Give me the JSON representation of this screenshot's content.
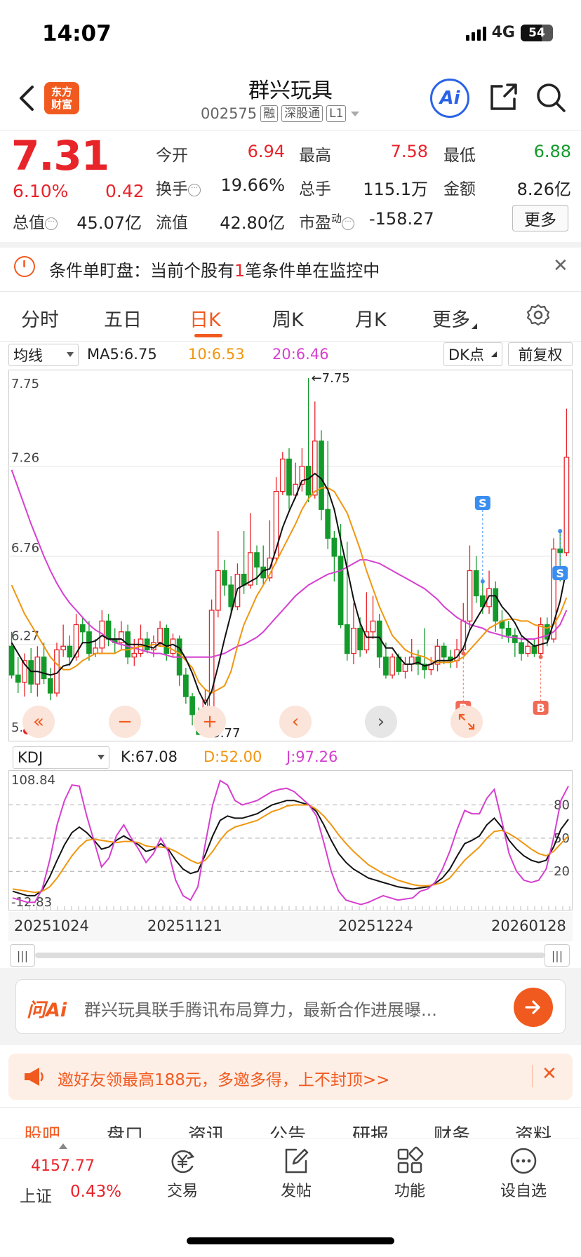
{
  "status_bar": {
    "time": "14:07",
    "network": "4G",
    "battery": "54"
  },
  "header": {
    "title": "群兴玩具",
    "code": "002575",
    "tags": [
      "融",
      "深股通",
      "L1"
    ],
    "logo": "东方财富",
    "ai_label": "Ai"
  },
  "quote": {
    "price": "7.31",
    "change_pct": "6.10%",
    "change": "0.42",
    "fields": [
      {
        "label": "今开",
        "value": "6.94",
        "color": "red"
      },
      {
        "label": "最高",
        "value": "7.58",
        "color": "red"
      },
      {
        "label": "最低",
        "value": "6.88",
        "color": "green"
      },
      {
        "label": "换手",
        "value": "19.66%",
        "color": "black"
      },
      {
        "label": "总手",
        "value": "115.1万",
        "color": "black"
      },
      {
        "label": "金额",
        "value": "8.26亿",
        "color": "black"
      },
      {
        "label": "总值",
        "value": "45.07亿",
        "color": "black"
      },
      {
        "label": "流值",
        "value": "42.80亿",
        "color": "black"
      },
      {
        "label": "市盈",
        "value": "-158.27",
        "color": "black"
      }
    ],
    "pe_sup": "动",
    "more_label": "更多"
  },
  "condition_banner": {
    "prefix": "条件单盯盘：当前个股有",
    "count": "1",
    "suffix": "笔条件单在监控中"
  },
  "tabs": [
    "分时",
    "五日",
    "日K",
    "周K",
    "月K",
    "更多"
  ],
  "active_tab": "日K",
  "indicator_row": {
    "selector": "均线",
    "ma5": "MA5:6.75",
    "ma10": "10:6.53",
    "ma20": "20:6.46",
    "dk_label": "DK点",
    "adjust_label": "前复权"
  },
  "kdj_row": {
    "selector": "KDJ",
    "k": "K:67.08",
    "d": "D:52.00",
    "j": "J:97.26"
  },
  "colors": {
    "up": "#e8242b",
    "down": "#139a2a",
    "ma5": "#111111",
    "ma10": "#f0960f",
    "ma20": "#d63fd0",
    "accent": "#f15a1f"
  },
  "chart_data": [
    {
      "type": "candlestick",
      "y_labels": [
        "7.75",
        "7.26",
        "6.76",
        "6.27",
        "5.77"
      ],
      "ylim": [
        5.77,
        7.75
      ],
      "max_label": "7.75",
      "min_label": "5.77",
      "signals": [
        "S",
        "S",
        "B",
        "B"
      ],
      "candles": [
        [
          6.26,
          6.1,
          6.34,
          6.08
        ],
        [
          6.1,
          6.06,
          6.2,
          6.0
        ],
        [
          6.06,
          6.18,
          6.22,
          5.98
        ],
        [
          6.18,
          6.05,
          6.25,
          6.0
        ],
        [
          6.05,
          6.2,
          6.26,
          5.98
        ],
        [
          6.2,
          6.08,
          6.28,
          6.05
        ],
        [
          6.08,
          6.0,
          6.14,
          5.96
        ],
        [
          6.0,
          6.24,
          6.28,
          5.98
        ],
        [
          6.24,
          6.26,
          6.38,
          6.2
        ],
        [
          6.26,
          6.2,
          6.32,
          6.15
        ],
        [
          6.2,
          6.38,
          6.44,
          6.18
        ],
        [
          6.38,
          6.34,
          6.42,
          6.28
        ],
        [
          6.34,
          6.22,
          6.4,
          6.18
        ],
        [
          6.22,
          6.25,
          6.3,
          6.2
        ],
        [
          6.25,
          6.4,
          6.46,
          6.22
        ],
        [
          6.4,
          6.3,
          6.44,
          6.26
        ],
        [
          6.3,
          6.28,
          6.36,
          6.22
        ],
        [
          6.28,
          6.34,
          6.4,
          6.24
        ],
        [
          6.34,
          6.2,
          6.38,
          6.16
        ],
        [
          6.2,
          6.22,
          6.3,
          6.15
        ],
        [
          6.22,
          6.3,
          6.38,
          6.2
        ],
        [
          6.3,
          6.24,
          6.34,
          6.22
        ],
        [
          6.24,
          6.28,
          6.32,
          6.2
        ],
        [
          6.28,
          6.36,
          6.4,
          6.26
        ],
        [
          6.36,
          6.22,
          6.38,
          6.18
        ],
        [
          6.22,
          6.3,
          6.33,
          6.2
        ],
        [
          6.3,
          6.1,
          6.32,
          6.04
        ],
        [
          6.1,
          5.98,
          6.14,
          5.94
        ],
        [
          5.98,
          5.88,
          6.0,
          5.82
        ],
        [
          5.88,
          5.77,
          5.92,
          5.77
        ],
        [
          5.84,
          5.96,
          6.02,
          5.82
        ],
        [
          5.92,
          6.46,
          6.52,
          5.9
        ],
        [
          6.46,
          6.68,
          6.9,
          6.42
        ],
        [
          6.68,
          6.6,
          6.74,
          6.54
        ],
        [
          6.6,
          6.48,
          6.65,
          6.44
        ],
        [
          6.48,
          6.66,
          6.72,
          6.46
        ],
        [
          6.66,
          6.6,
          6.9,
          6.55
        ],
        [
          6.6,
          6.78,
          7.0,
          6.58
        ],
        [
          6.78,
          6.7,
          6.82,
          6.6
        ],
        [
          6.7,
          6.64,
          6.82,
          6.6
        ],
        [
          6.64,
          6.75,
          6.96,
          6.62
        ],
        [
          6.75,
          7.12,
          7.2,
          6.72
        ],
        [
          7.12,
          7.3,
          7.34,
          7.1
        ],
        [
          7.3,
          7.1,
          7.36,
          7.02
        ],
        [
          7.1,
          7.16,
          7.28,
          7.08
        ],
        [
          7.16,
          7.26,
          7.36,
          7.12
        ],
        [
          7.26,
          7.1,
          7.75,
          7.06
        ],
        [
          7.1,
          7.4,
          7.62,
          7.08
        ],
        [
          7.4,
          7.02,
          7.46,
          6.96
        ],
        [
          7.02,
          6.86,
          7.4,
          6.8
        ],
        [
          6.86,
          6.76,
          6.9,
          6.62
        ],
        [
          6.76,
          6.38,
          6.94,
          6.36
        ],
        [
          6.38,
          6.22,
          6.84,
          6.18
        ],
        [
          6.22,
          6.36,
          6.5,
          6.16
        ],
        [
          6.36,
          6.24,
          6.42,
          6.2
        ],
        [
          6.24,
          6.34,
          6.56,
          6.22
        ],
        [
          6.34,
          6.4,
          6.54,
          6.3
        ],
        [
          6.4,
          6.2,
          6.44,
          6.14
        ],
        [
          6.2,
          6.1,
          6.28,
          6.08
        ],
        [
          6.1,
          6.2,
          6.22,
          6.08
        ],
        [
          6.2,
          6.12,
          6.22,
          6.1
        ],
        [
          6.12,
          6.16,
          6.2,
          6.08
        ],
        [
          6.16,
          6.2,
          6.3,
          6.12
        ],
        [
          6.2,
          6.16,
          6.24,
          6.1
        ],
        [
          6.16,
          6.13,
          6.36,
          6.08
        ],
        [
          6.13,
          6.16,
          6.2,
          6.1
        ],
        [
          6.16,
          6.26,
          6.3,
          6.12
        ],
        [
          6.26,
          6.2,
          6.28,
          6.16
        ],
        [
          6.2,
          6.18,
          6.24,
          6.14
        ],
        [
          6.18,
          6.24,
          6.3,
          6.14
        ],
        [
          6.24,
          6.4,
          6.5,
          6.22
        ],
        [
          6.4,
          6.68,
          6.82,
          6.36
        ],
        [
          6.68,
          6.54,
          6.76,
          6.5
        ],
        [
          6.54,
          6.48,
          6.62,
          6.44
        ],
        [
          6.48,
          6.58,
          6.68,
          6.44
        ],
        [
          6.58,
          6.4,
          6.62,
          6.34
        ],
        [
          6.4,
          6.36,
          6.46,
          6.3
        ],
        [
          6.36,
          6.32,
          6.4,
          6.28
        ],
        [
          6.32,
          6.28,
          6.36,
          6.2
        ],
        [
          6.28,
          6.22,
          6.32,
          6.18
        ],
        [
          6.22,
          6.26,
          6.3,
          6.2
        ],
        [
          6.26,
          6.22,
          6.3,
          6.2
        ],
        [
          6.22,
          6.38,
          6.42,
          6.2
        ],
        [
          6.38,
          6.3,
          6.42,
          6.26
        ],
        [
          6.3,
          6.8,
          6.86,
          6.28
        ],
        [
          6.8,
          6.78,
          6.9,
          6.62
        ],
        [
          6.78,
          7.31,
          7.58,
          6.76
        ]
      ],
      "ma5": [
        6.28,
        6.22,
        6.16,
        6.12,
        6.12,
        6.11,
        6.1,
        6.11,
        6.15,
        6.16,
        6.22,
        6.28,
        6.28,
        6.29,
        6.32,
        6.3,
        6.3,
        6.3,
        6.27,
        6.27,
        6.27,
        6.26,
        6.25,
        6.28,
        6.26,
        6.27,
        6.25,
        6.19,
        6.11,
        6.01,
        5.94,
        6.01,
        6.15,
        6.3,
        6.44,
        6.58,
        6.6,
        6.62,
        6.64,
        6.68,
        6.69,
        6.8,
        6.92,
        7.01,
        7.09,
        7.18,
        7.19,
        7.22,
        7.19,
        7.13,
        7.02,
        6.85,
        6.69,
        6.52,
        6.39,
        6.31,
        6.31,
        6.31,
        6.25,
        6.25,
        6.2,
        6.16,
        6.16,
        6.17,
        6.15,
        6.16,
        6.18,
        6.18,
        6.18,
        6.2,
        6.25,
        6.35,
        6.41,
        6.47,
        6.54,
        6.54,
        6.48,
        6.44,
        6.39,
        6.32,
        6.29,
        6.26,
        6.27,
        6.28,
        6.39,
        6.51,
        6.69
      ],
      "ma10": [
        6.6,
        6.52,
        6.44,
        6.38,
        6.32,
        6.26,
        6.2,
        6.16,
        6.13,
        6.13,
        6.15,
        6.18,
        6.2,
        6.22,
        6.22,
        6.22,
        6.22,
        6.24,
        6.24,
        6.25,
        6.26,
        6.26,
        6.27,
        6.26,
        6.26,
        6.24,
        6.22,
        6.18,
        6.14,
        6.06,
        6.02,
        6.0,
        6.02,
        6.04,
        6.12,
        6.26,
        6.38,
        6.46,
        6.54,
        6.6,
        6.66,
        6.73,
        6.8,
        6.87,
        6.94,
        7.02,
        7.08,
        7.12,
        7.14,
        7.14,
        7.12,
        7.06,
        7.0,
        6.9,
        6.8,
        6.68,
        6.58,
        6.48,
        6.4,
        6.32,
        6.28,
        6.24,
        6.22,
        6.21,
        6.2,
        6.18,
        6.17,
        6.17,
        6.17,
        6.18,
        6.2,
        6.24,
        6.28,
        6.32,
        6.36,
        6.38,
        6.4,
        6.41,
        6.41,
        6.4,
        6.4,
        6.38,
        6.37,
        6.36,
        6.38,
        6.44,
        6.53
      ],
      "ma20": [
        7.24,
        7.14,
        7.04,
        6.94,
        6.85,
        6.76,
        6.68,
        6.61,
        6.55,
        6.5,
        6.46,
        6.42,
        6.38,
        6.35,
        6.33,
        6.3,
        6.28,
        6.27,
        6.26,
        6.25,
        6.24,
        6.23,
        6.22,
        6.22,
        6.21,
        6.2,
        6.2,
        6.2,
        6.2,
        6.2,
        6.2,
        6.2,
        6.21,
        6.22,
        6.24,
        6.26,
        6.27,
        6.29,
        6.31,
        6.34,
        6.38,
        6.42,
        6.46,
        6.5,
        6.54,
        6.57,
        6.6,
        6.62,
        6.64,
        6.66,
        6.67,
        6.68,
        6.7,
        6.72,
        6.74,
        6.74,
        6.73,
        6.72,
        6.7,
        6.68,
        6.66,
        6.64,
        6.62,
        6.6,
        6.58,
        6.55,
        6.52,
        6.48,
        6.45,
        6.42,
        6.4,
        6.38,
        6.37,
        6.36,
        6.34,
        6.33,
        6.32,
        6.31,
        6.31,
        6.3,
        6.3,
        6.3,
        6.31,
        6.32,
        6.34,
        6.38,
        6.46
      ]
    },
    {
      "type": "line",
      "y_labels": [
        "108.84",
        "80",
        "50",
        "20",
        "-12.83"
      ],
      "ylim": [
        -12.83,
        108.84
      ],
      "x_labels": [
        "20251024",
        "20251121",
        "20251224",
        "20260128"
      ],
      "series": [
        {
          "name": "K",
          "values": [
            2,
            0,
            -2,
            -2,
            3,
            15,
            30,
            44,
            55,
            60,
            55,
            48,
            40,
            42,
            48,
            52,
            48,
            44,
            38,
            40,
            45,
            40,
            30,
            22,
            18,
            20,
            35,
            52,
            66,
            70,
            68,
            68,
            70,
            72,
            76,
            80,
            82,
            84,
            84,
            82,
            80,
            74,
            62,
            48,
            36,
            28,
            22,
            18,
            14,
            12,
            10,
            8,
            6,
            5,
            4,
            5,
            6,
            9,
            14,
            22,
            34,
            45,
            48,
            52,
            62,
            68,
            60,
            48,
            40,
            34,
            30,
            28,
            30,
            42,
            58,
            67
          ]
        },
        {
          "name": "D",
          "values": [
            4,
            3,
            2,
            1,
            2,
            6,
            14,
            24,
            34,
            42,
            48,
            49,
            48,
            47,
            46,
            47,
            47,
            46,
            43,
            42,
            42,
            41,
            38,
            34,
            30,
            27,
            30,
            38,
            48,
            56,
            60,
            62,
            64,
            66,
            70,
            74,
            76,
            79,
            80,
            80,
            80,
            76,
            70,
            62,
            53,
            45,
            38,
            32,
            26,
            22,
            18,
            15,
            12,
            10,
            8,
            7,
            7,
            8,
            10,
            14,
            22,
            30,
            36,
            42,
            50,
            56,
            57,
            54,
            50,
            45,
            40,
            36,
            34,
            38,
            45,
            52
          ]
        },
        {
          "name": "J",
          "values": [
            -4,
            -6,
            -8,
            -8,
            4,
            30,
            62,
            84,
            98,
            97,
            70,
            47,
            24,
            32,
            52,
            62,
            50,
            40,
            28,
            36,
            50,
            38,
            12,
            -2,
            -6,
            6,
            45,
            80,
            102,
            98,
            84,
            80,
            82,
            84,
            88,
            92,
            94,
            95,
            92,
            86,
            80,
            70,
            46,
            20,
            2,
            -6,
            -8,
            -10,
            -8,
            -5,
            -2,
            -4,
            -6,
            -5,
            -4,
            2,
            4,
            10,
            22,
            38,
            58,
            75,
            72,
            72,
            86,
            94,
            66,
            36,
            20,
            12,
            10,
            12,
            22,
            50,
            84,
            97
          ]
        }
      ]
    }
  ],
  "chart_nav": [
    "«",
    "−",
    "+",
    "‹",
    "›"
  ],
  "ask_ai": {
    "logo": "问Ai",
    "text": "群兴玩具联手腾讯布局算力，最新合作进展曝..."
  },
  "invite": {
    "text": "邀好友领最高188元，多邀多得，上不封顶>>"
  },
  "sub_tabs": [
    "股吧",
    "盘口",
    "资讯",
    "公告",
    "研报",
    "财务",
    "资料"
  ],
  "bottom_nav": {
    "index_value": "4157.77",
    "index_name": "上证",
    "index_pct": "0.43%",
    "items": [
      {
        "label": "交易",
        "icon": "yuan-cycle-icon"
      },
      {
        "label": "发帖",
        "icon": "edit-icon"
      },
      {
        "label": "功能",
        "icon": "grid-icon"
      },
      {
        "label": "设自选",
        "icon": "more-dots-icon"
      }
    ]
  }
}
